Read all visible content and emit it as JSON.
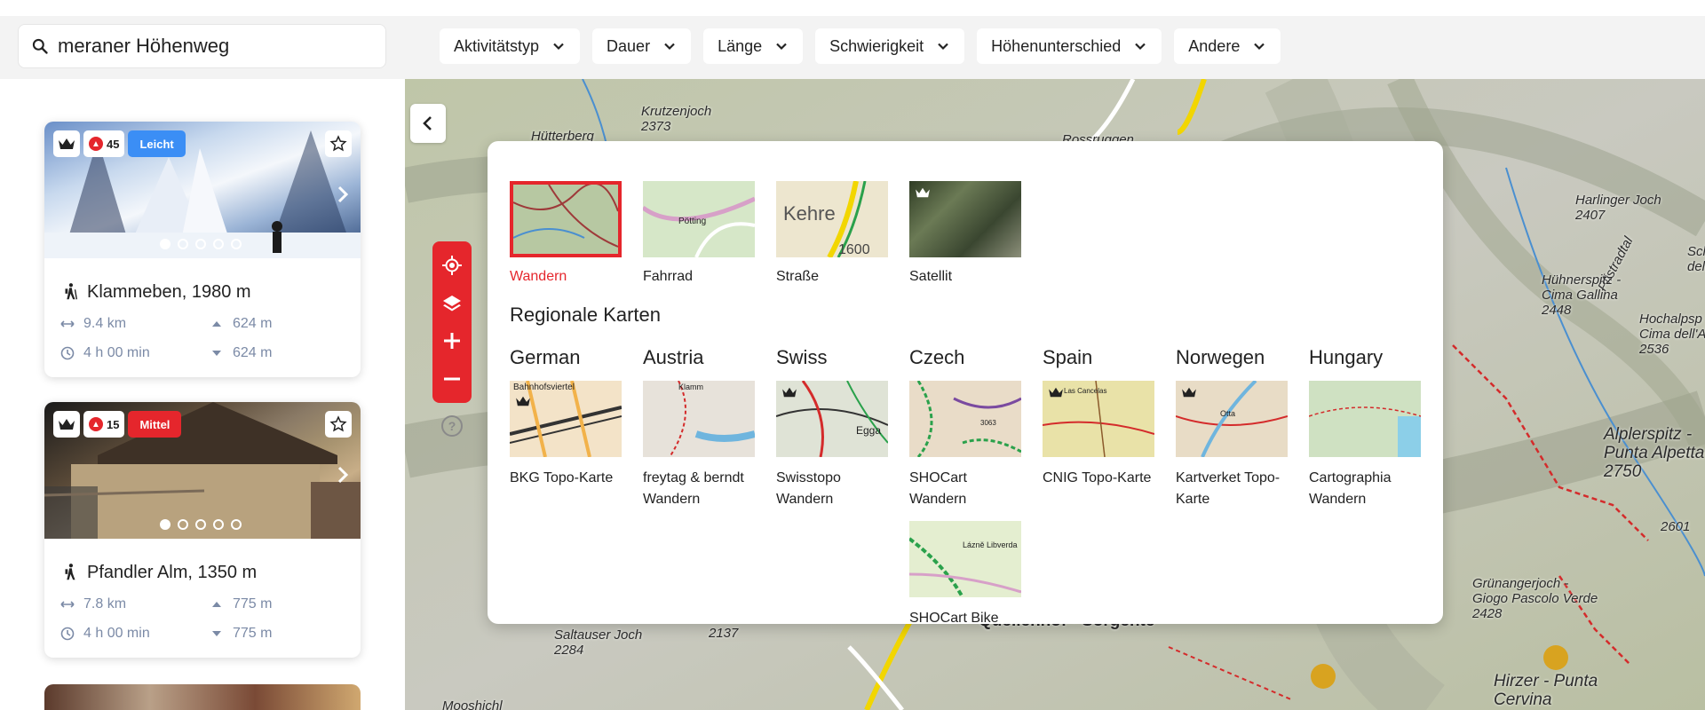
{
  "search": {
    "value": "meraner Höhenweg",
    "placeholder": ""
  },
  "filters": [
    "Aktivitätstyp",
    "Dauer",
    "Länge",
    "Schwierigkeit",
    "Höhenunterschied",
    "Andere"
  ],
  "cards": [
    {
      "popularity": "45",
      "difficulty": "Leicht",
      "difficulty_color": "#3b8ef5",
      "title": "Klammeben, 1980 m",
      "distance": "9.4 km",
      "ascent": "624 m",
      "duration": "4 h 00 min",
      "descent": "624 m",
      "slide_count": 5,
      "active_slide": 1
    },
    {
      "popularity": "15",
      "difficulty": "Mittel",
      "difficulty_color": "#e5262c",
      "title": "Pfandler Alm, 1350 m",
      "distance": "7.8 km",
      "ascent": "775 m",
      "duration": "4 h 00 min",
      "descent": "775 m",
      "slide_count": 5,
      "active_slide": 1
    }
  ],
  "map_labels": [
    {
      "text": "Krutzenjoch\n2373"
    },
    {
      "text": "Hütterberg"
    },
    {
      "text": "Rossruggen"
    },
    {
      "text": "Harlinger Joch\n2407"
    },
    {
      "text": "Pfistradtal"
    },
    {
      "text": "Hühnerspitz -\nCima Gallina\n2448"
    },
    {
      "text": "Hochalpsp\nCima dell'A\n2536"
    },
    {
      "text": "Sch\ndell\n"
    },
    {
      "text": "Alplerspitz -\nPunta Alpetta\n2750"
    },
    {
      "text": "2601"
    },
    {
      "text": "Grünangerjoch -\nGiogo Pascolo Verde\n2428"
    },
    {
      "text": "Hirzer - Punta\nCervina"
    },
    {
      "text": "Saltauser Joch\n2284"
    },
    {
      "text": "2137"
    },
    {
      "text": "Mooshichl"
    },
    {
      "text": "Quellenhof - Sorgente"
    }
  ],
  "map_layers": {
    "base": [
      {
        "label": "Wandern",
        "selected": true,
        "premium": false
      },
      {
        "label": "Fahrrad",
        "selected": false,
        "premium": false,
        "thumb_text": "Pötting"
      },
      {
        "label": "Straße",
        "selected": false,
        "premium": false,
        "thumb_text": "Kehre",
        "thumb_num": "1600"
      },
      {
        "label": "Satellit",
        "selected": false,
        "premium": true
      }
    ],
    "regional_title": "Regionale Karten",
    "countries": [
      "German",
      "Austria",
      "Swiss",
      "Czech",
      "Spain",
      "Norwegen",
      "Hungary"
    ],
    "regional": [
      {
        "label": "BKG Topo-Karte",
        "premium": true,
        "thumb_text": "Bahnhofsviertel"
      },
      {
        "label": "freytag & berndt Wandern",
        "premium": false,
        "thumb_text": "Klamm"
      },
      {
        "label": "Swisstopo Wandern",
        "premium": true,
        "thumb_text": "Egga"
      },
      {
        "label": "SHOCart Wandern",
        "premium": false,
        "thumb_text": "3063"
      },
      {
        "label": "CNIG Topo-Karte",
        "premium": true,
        "thumb_text": "Las Cancelas"
      },
      {
        "label": "Kartverket Topo-Karte",
        "premium": true,
        "thumb_text": "Otta"
      },
      {
        "label": "Cartographia Wandern",
        "premium": false
      },
      {
        "label": "SHOCart Bike",
        "premium": false,
        "thumb_text": "Lázně Libverda"
      }
    ]
  },
  "colors": {
    "accent": "#e5262c",
    "easy": "#3b8ef5",
    "stat_text": "#7b8aa6"
  }
}
